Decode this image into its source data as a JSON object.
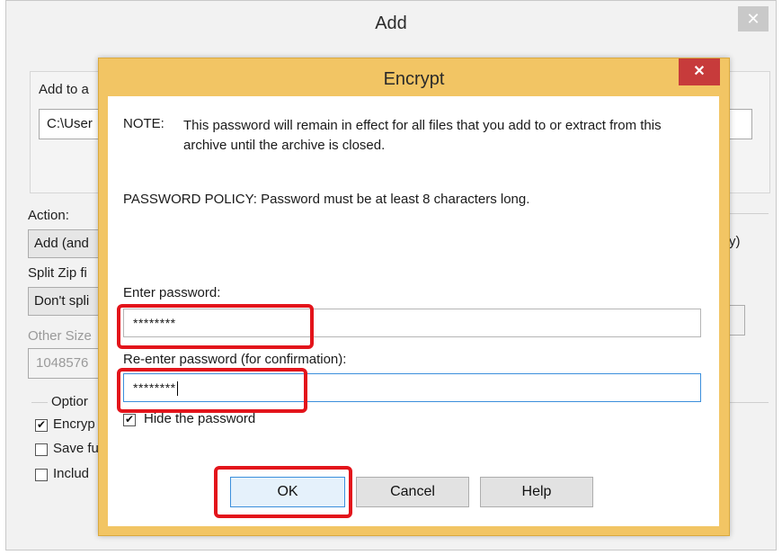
{
  "add_window": {
    "title": "Add",
    "add_to_archive_label": "Add to a",
    "path_value": "C:\\User",
    "action_label": "Action:",
    "action_value": "Add (and",
    "right_fragment": "y)",
    "split_label": "Split Zip fi",
    "split_value": "Don't spli",
    "other_size_label": "Other Size",
    "other_size_value": "1048576",
    "options_label": "Optior",
    "opt_encrypt": "Encryp",
    "opt_save": "Save fu",
    "opt_include": "Includ"
  },
  "encrypt_dialog": {
    "title": "Encrypt",
    "close_glyph": "✕",
    "note_label": "NOTE:",
    "note_text": "This password will remain in effect for all files that you add to or extract from this archive until the archive is closed.",
    "policy_text": "PASSWORD POLICY: Password must be at least 8 characters long.",
    "enter_label": "Enter password:",
    "enter_value": "********",
    "reenter_label": "Re-enter password (for confirmation):",
    "reenter_value": "********",
    "hide_label": "Hide the password",
    "hide_checked": true,
    "ok_label": "OK",
    "cancel_label": "Cancel",
    "help_label": "Help"
  },
  "colors": {
    "dialog_frame": "#f2c564",
    "close_button": "#c73b3b",
    "highlight": "#e3141b",
    "focus_border": "#3c8fdc"
  }
}
